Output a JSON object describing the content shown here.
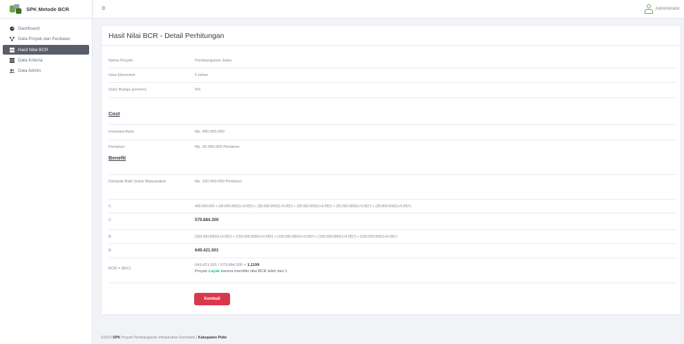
{
  "brand": {
    "title": "SPK Metode BCR"
  },
  "sidebar": {
    "items": [
      {
        "label": "Dashboard",
        "icon": "dashboard-icon",
        "active": false
      },
      {
        "label": "Data Proyek dan Penilaian",
        "icon": "sitemap-icon",
        "active": false
      },
      {
        "label": "Hasil Nilai BCR",
        "icon": "table-icon",
        "active": true
      },
      {
        "label": "Data Kriteria",
        "icon": "table-icon",
        "active": false
      },
      {
        "label": "Data Admin",
        "icon": "users-icon",
        "active": false
      }
    ]
  },
  "topbar": {
    "user_name": "Administrator"
  },
  "page": {
    "title": "Hasil Nilai BCR - Detail Perhitungan"
  },
  "info": {
    "nama_proyek_label": "Nama Proyek",
    "nama_proyek_value": "Pembangunan Jalan",
    "usia_label": "Usia Ekonomis",
    "usia_value": "5 tahun",
    "suku_label": "Suku Bunga (persen)",
    "suku_value": "5%"
  },
  "cost": {
    "heading": "Cost",
    "investasi_label": "Investasi Awal",
    "investasi_value": "Rp. 450.000.000",
    "pertahun_label": "Pertahun",
    "pertahun_value": "Rp. 30.000.000 Pertahun"
  },
  "benefit": {
    "heading": "Benefit",
    "dampak_label": "Dampak Baik Untuk Masyarakat",
    "dampak_value": "Rp. 150.000.000 Pertahun"
  },
  "calc": {
    "c_label": "C",
    "c_formula": "450.000.000 + (30.000.000/(1+0.05)¹) + (30.000.000/(1+0.05)²) + (30.000.000/(1+0.05)³) + (30.000.000/(1+0.05)⁴) + (30.000.000/(1+0.05)⁵)",
    "c_result": "579.884.300",
    "b_label": "B",
    "b_formula": "(150.000.000/(1+0.05)¹) + (150.000.000/(1+0.05)²) + (150.000.000/(1+0.05)³) + (150.000.000/(1+0.05)⁴) + (150.000.000/(1+0.05)⁵)",
    "b_result": "649.421.501",
    "bcr_label": "BCR = (B/C)",
    "bcr_expr": "649.421.501 / 579.884.300 = ",
    "bcr_value": "1,1199",
    "proyek_text": "Proyek ",
    "layak_text": "Layak",
    "reason_text": " karena memiliki nilai BCR lebih dari 1"
  },
  "buttons": {
    "kembali": "Kembali"
  },
  "footer": {
    "prefix": "©2023 ",
    "spk": "SPK",
    "middle": " Proyek Pembangunan Infrastruktur Gorontalo | ",
    "kabupaten": "Kabupaten Pidie"
  },
  "colors": {
    "active_nav": "#5a5c69",
    "kembali_button": "#d9374b",
    "layak_text": "#1cc88a",
    "user_icon": "#6aa84f"
  }
}
